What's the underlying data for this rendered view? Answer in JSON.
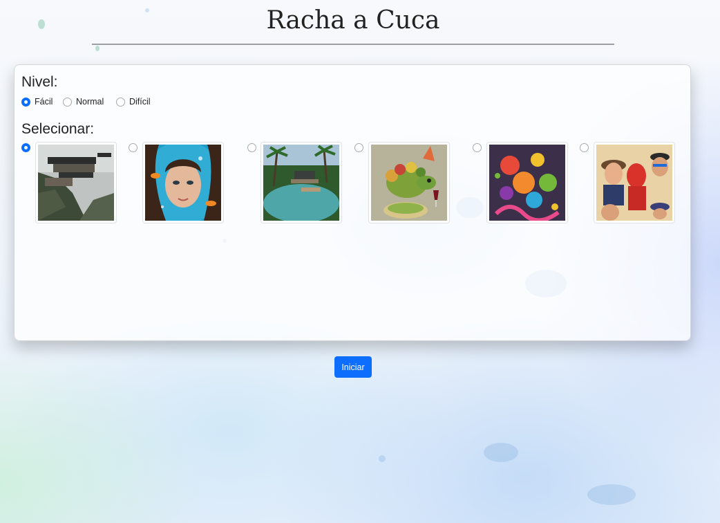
{
  "page": {
    "title": "Racha a Cuca"
  },
  "level": {
    "label": "Nivel:",
    "options": [
      {
        "label": "Fácil",
        "selected": true
      },
      {
        "label": "Normal",
        "selected": false
      },
      {
        "label": "Difícil",
        "selected": false
      }
    ]
  },
  "select": {
    "label": "Selecionar:",
    "images": [
      {
        "subject": "cliffside modern house",
        "selected": true
      },
      {
        "subject": "underwater girl with fish",
        "selected": false
      },
      {
        "subject": "tropical pool villa",
        "selected": false
      },
      {
        "subject": "fruit chameleon with wine glass",
        "selected": false
      },
      {
        "subject": "fruit color splash",
        "selected": false
      },
      {
        "subject": "comic characters collage",
        "selected": false
      }
    ]
  },
  "actions": {
    "start_label": "Iniciar"
  },
  "colors": {
    "accent": "#0d6efd"
  }
}
